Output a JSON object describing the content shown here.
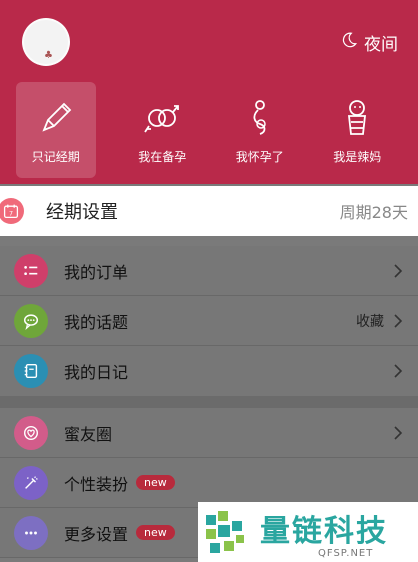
{
  "header": {
    "night_label": "夜间",
    "modes": [
      {
        "label": "只记经期"
      },
      {
        "label": "我在备孕"
      },
      {
        "label": "我怀孕了"
      },
      {
        "label": "我是辣妈"
      }
    ]
  },
  "cycle_setting": {
    "title": "经期设置",
    "value": "周期28天",
    "calendar_day": "7"
  },
  "menu_group_1": [
    {
      "label": "我的订单"
    },
    {
      "label": "我的话题",
      "right": "收藏"
    },
    {
      "label": "我的日记"
    }
  ],
  "menu_group_2": [
    {
      "label": "蜜友圈"
    },
    {
      "label": "个性装扮",
      "badge": "new"
    },
    {
      "label": "更多设置",
      "badge": "new"
    }
  ],
  "colors": {
    "header_bg": "#b9294a",
    "orders_icon": "#cf3f6a",
    "topics_icon": "#6fa63a",
    "diary_icon": "#2b8fb3",
    "circle_icon": "#d25c8a",
    "dressup_icon": "#7c62c7",
    "settings_icon": "#7d6fc2"
  },
  "watermark": {
    "brand": "量链科技",
    "url": "QFSP.NET"
  }
}
